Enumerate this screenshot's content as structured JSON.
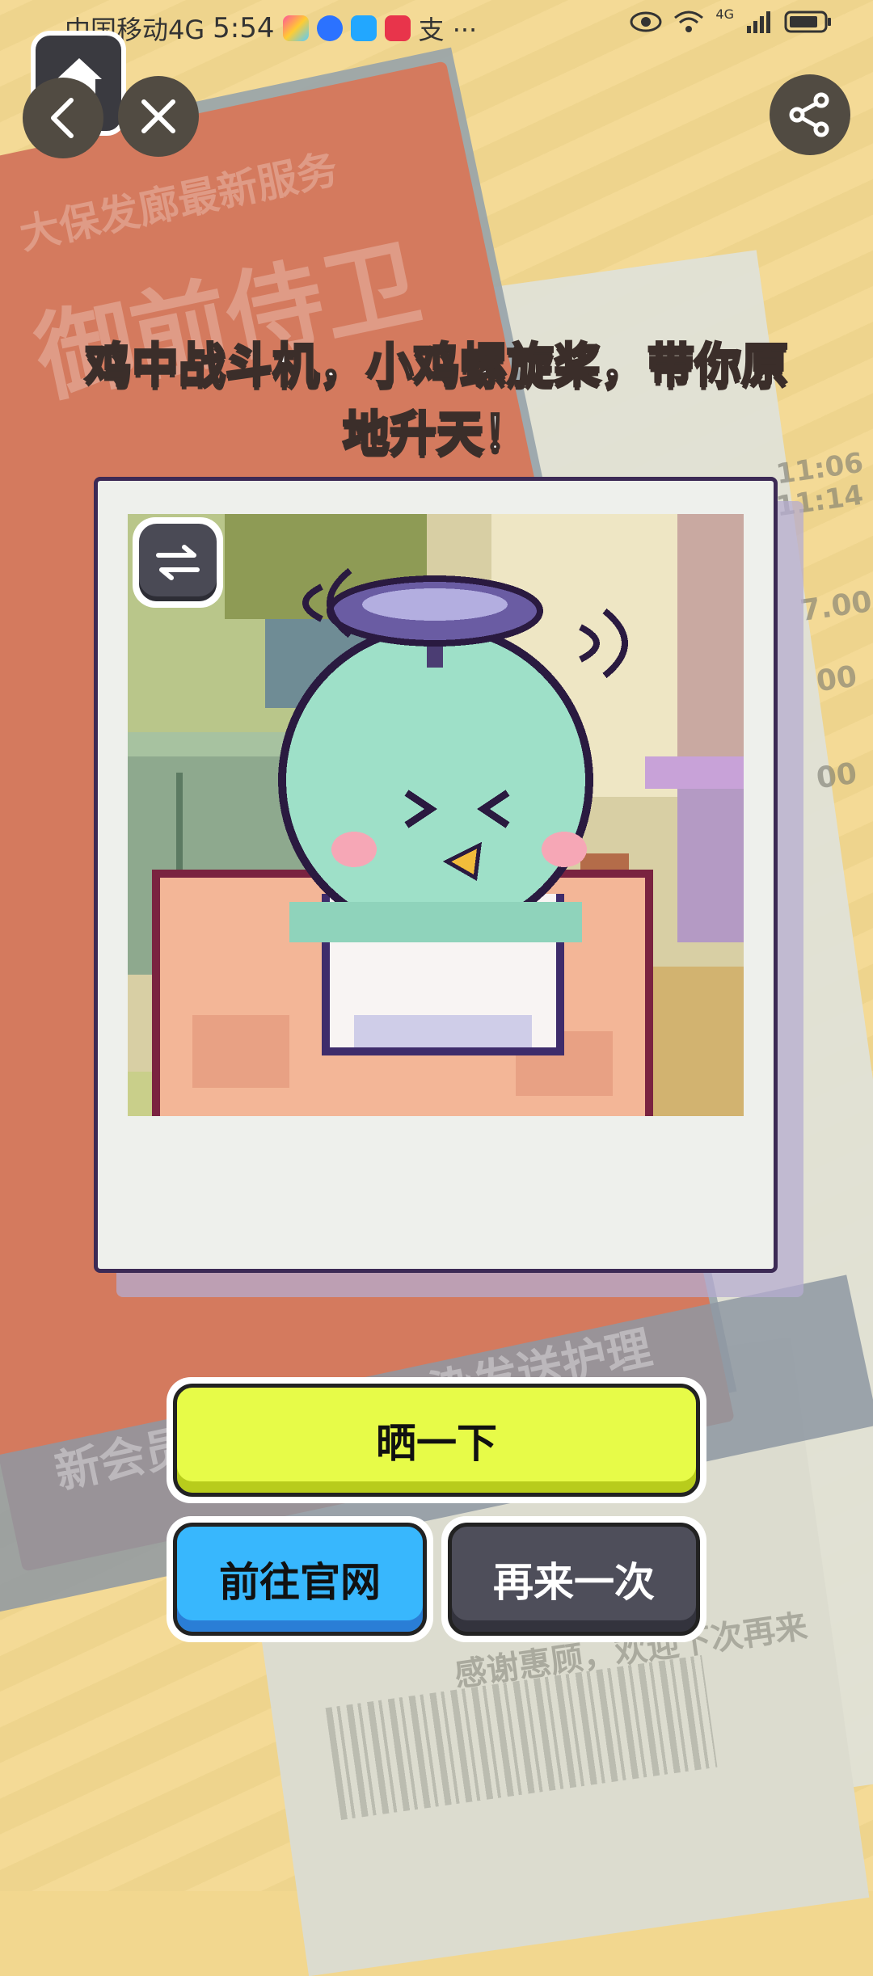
{
  "status_bar": {
    "carrier": "中国移动4G",
    "time": "5:54",
    "extra": "支 ···",
    "network": "4G"
  },
  "headline": {
    "line1": "鸡中战斗机，小鸡螺旋桨，带你原",
    "line2": "地升天！"
  },
  "buttons": {
    "share_label": "晒一下",
    "official_label": "前往官网",
    "retry_label": "再来一次"
  },
  "background_text": {
    "poster_small": "大保发廊最新服务",
    "poster_big": "御前侍卫",
    "band": "新会员 充值500，染发送护理",
    "receipt_bottom": "感谢惠顾，欢迎下次再来",
    "receipt_prices": [
      "7.00",
      "00",
      "00"
    ],
    "receipt_times": [
      "11:06",
      "11:14"
    ]
  },
  "icons": {
    "home": "home-icon",
    "back": "chevron-left-icon",
    "close": "close-icon",
    "share": "share-icon",
    "swap": "swap-icon"
  },
  "colors": {
    "share_button": "#e7fb48",
    "official_button": "#38b7fd",
    "retry_button": "#4e4e5a",
    "background": "#f3d890"
  }
}
